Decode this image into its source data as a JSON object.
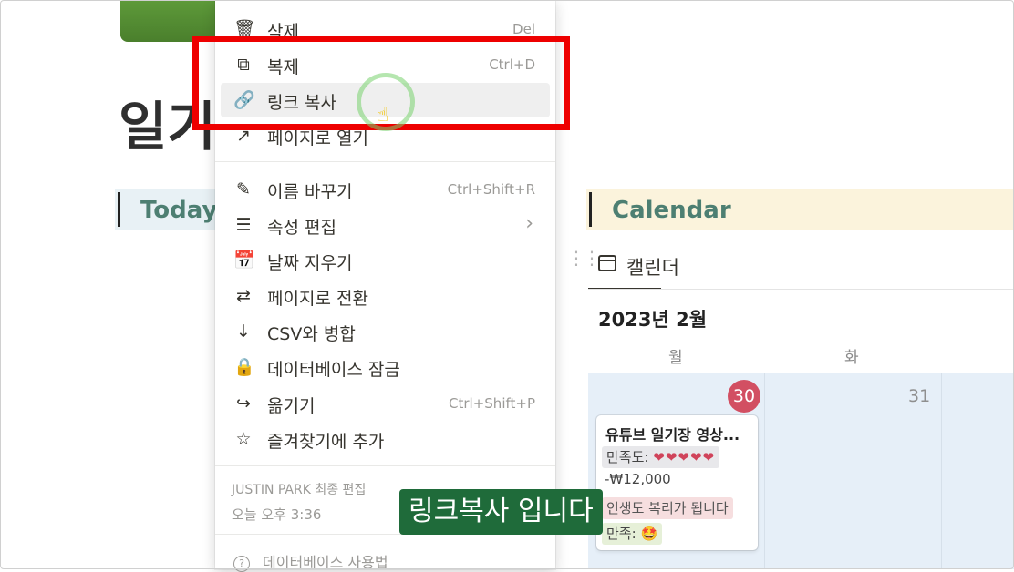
{
  "page": {
    "title": "일기",
    "today_header": "Today",
    "calendar_header": "Calendar"
  },
  "calendar": {
    "view_tab": "캘린더",
    "month": "2023년 2월",
    "weekdays": [
      "월",
      "화"
    ],
    "days": [
      "30",
      "31"
    ],
    "card": {
      "title": "유튜브 일기장 영상...",
      "satisfaction_label": "만족도:",
      "hearts": "❤❤❤❤❤",
      "amount": "-₩12,000",
      "note": "인생도 복리가 됩니다",
      "mood_label": "만족:",
      "mood_emoji": "🤩"
    }
  },
  "menu": {
    "items": [
      {
        "icon": "trash-icon",
        "glyph": "🗑",
        "label": "삭제",
        "shortcut": "Del"
      },
      {
        "icon": "duplicate-icon",
        "glyph": "⧉",
        "label": "복제",
        "shortcut": "Ctrl+D"
      },
      {
        "icon": "link-icon",
        "glyph": "🔗",
        "label": "링크 복사",
        "shortcut": ""
      },
      {
        "icon": "open-page-icon",
        "glyph": "↗",
        "label": "페이지로 열기",
        "shortcut": ""
      },
      {
        "icon": "rename-icon",
        "glyph": "✎",
        "label": "이름 바꾸기",
        "shortcut": "Ctrl+Shift+R"
      },
      {
        "icon": "list-icon",
        "glyph": "☰",
        "label": "속성 편집",
        "shortcut": ""
      },
      {
        "icon": "calendar-clear-icon",
        "glyph": "📅",
        "label": "날짜 지우기",
        "shortcut": ""
      },
      {
        "icon": "convert-icon",
        "glyph": "⇄",
        "label": "페이지로 전환",
        "shortcut": ""
      },
      {
        "icon": "download-icon",
        "glyph": "↓",
        "label": "CSV와 병합",
        "shortcut": ""
      },
      {
        "icon": "lock-icon",
        "glyph": "🔒",
        "label": "데이터베이스 잠금",
        "shortcut": ""
      },
      {
        "icon": "move-icon",
        "glyph": "↪",
        "label": "옮기기",
        "shortcut": "Ctrl+Shift+P"
      },
      {
        "icon": "star-icon",
        "glyph": "☆",
        "label": "즐겨찾기에 추가",
        "shortcut": ""
      }
    ],
    "submenu_chevron": "›",
    "edited_by": "JUSTIN PARK 최종 편집",
    "edited_time": "오늘 오후 3:36",
    "help": "데이터베이스 사용법"
  },
  "overlay": {
    "subtitle": "링크복사 입니다",
    "highlight_color": "#ee0000"
  }
}
